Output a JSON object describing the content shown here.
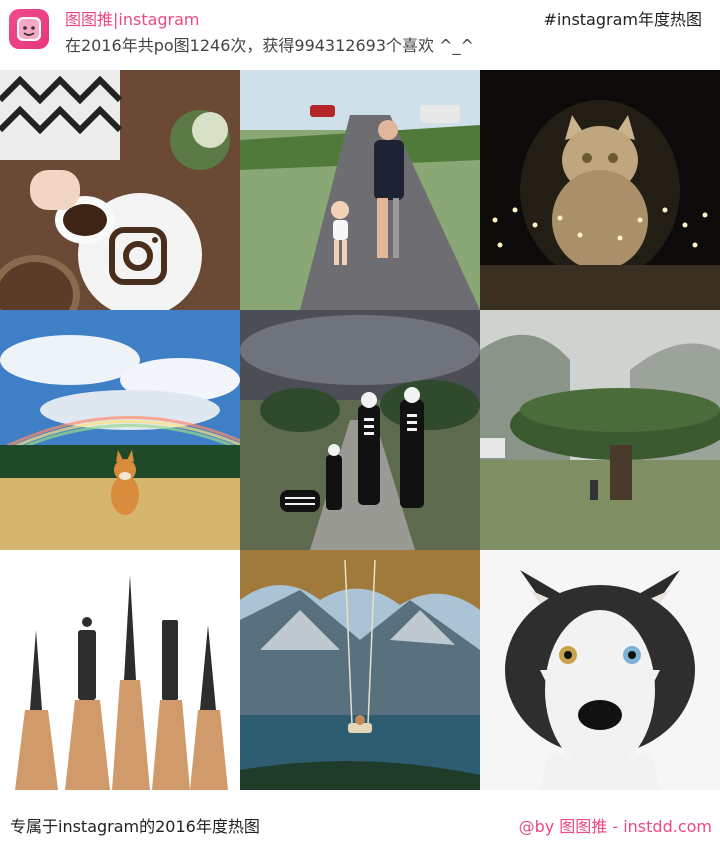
{
  "header": {
    "brand": "图图推|instagram",
    "stats": "在2016年共po图1246次，获得994312693个喜欢 ^_^",
    "hashtag": "#instagram年度热图"
  },
  "photos": [
    {
      "icon": "coffee-beans-instagram-logo-photo"
    },
    {
      "icon": "mother-with-prosthetic-leg-and-toddler-photo"
    },
    {
      "icon": "cat-with-fairy-lights-photo"
    },
    {
      "icon": "shiba-inu-rainbow-field-photo"
    },
    {
      "icon": "family-skeleton-costumes-photo"
    },
    {
      "icon": "mushroom-shaped-tree-photo"
    },
    {
      "icon": "pencil-tip-landmark-carvings-photo"
    },
    {
      "icon": "swing-over-fjord-photo"
    },
    {
      "icon": "husky-heterochromia-portrait-photo"
    }
  ],
  "footer": {
    "left": "专属于instagram的2016年度热图",
    "right": "@by 图图推 - instdd.com"
  },
  "colors": {
    "accent": "#ec4a7c"
  }
}
